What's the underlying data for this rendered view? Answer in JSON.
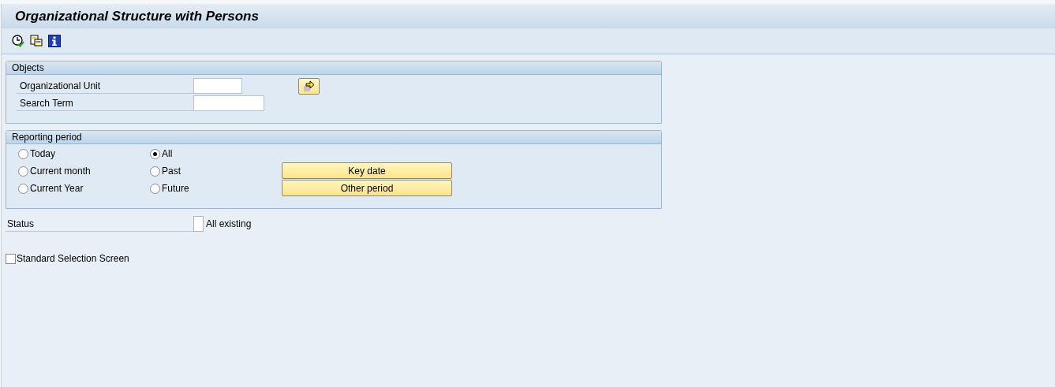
{
  "window": {
    "title": "Organizational Structure with Persons"
  },
  "toolbar": {
    "buttons": [
      {
        "kind": "execute"
      },
      {
        "kind": "variants"
      },
      {
        "kind": "info"
      }
    ]
  },
  "objects": {
    "title": "Objects",
    "fields": [
      {
        "label": "Organizational Unit",
        "kind": "selection"
      },
      {
        "label": "Search Term",
        "kind": "text"
      }
    ]
  },
  "reporting_period": {
    "title": "Reporting period",
    "options": [
      {
        "label": "Today",
        "selected": false
      },
      {
        "label": "All",
        "selected": true
      },
      {
        "label": "Current month",
        "selected": false
      },
      {
        "label": "Past",
        "selected": false
      },
      {
        "label": "Current Year",
        "selected": false
      },
      {
        "label": "Future",
        "selected": false
      }
    ],
    "buttons": [
      "Key date",
      "Other period"
    ]
  },
  "status": {
    "label": "Status",
    "checked": false,
    "text": "All existing"
  },
  "standard_selection": {
    "label": "Standard Selection Screen",
    "checked": false
  }
}
